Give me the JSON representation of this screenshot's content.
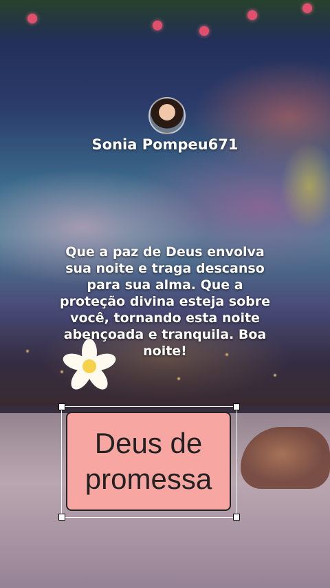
{
  "profile": {
    "username": "Sonia Pompeu671"
  },
  "message": {
    "text": "Que a paz de Deus envolva sua noite e traga descanso para sua alma. Que a proteção divina esteja sobre você, tornando esta noite abençoada e tranquila. Boa noite!"
  },
  "sticker": {
    "text": "Deus de promessa",
    "background_color": "#f7a6a2"
  },
  "icons": {
    "avatar": "profile-avatar",
    "flower": "plumeria-flower-icon"
  }
}
